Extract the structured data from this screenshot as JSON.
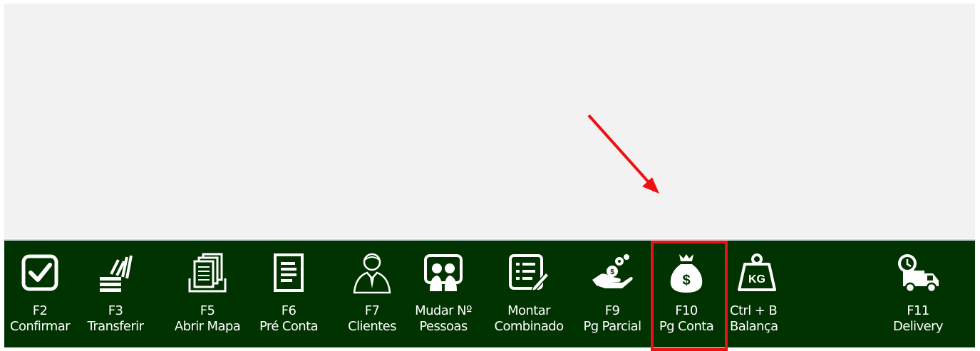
{
  "toolbar": {
    "buttons": [
      {
        "key": "F2",
        "label": "Confirmar",
        "icon": "checkbox-icon"
      },
      {
        "key": "F3",
        "label": "Transferir",
        "icon": "transfer-icon"
      },
      {
        "key": "F5",
        "label": "Abrir Mapa",
        "icon": "documents-stack-icon"
      },
      {
        "key": "F6",
        "label": "Pré Conta",
        "icon": "document-icon"
      },
      {
        "key": "F7",
        "label": "Clientes",
        "icon": "person-icon"
      },
      {
        "key": "Mudar Nº",
        "label": "Pessoas",
        "icon": "people-board-icon"
      },
      {
        "key": "Montar",
        "label": "Combinado",
        "icon": "list-edit-icon"
      },
      {
        "key": "F9",
        "label": "Pg Parcial",
        "icon": "hand-coins-icon"
      },
      {
        "key": "F10",
        "label": "Pg Conta",
        "icon": "money-bag-icon"
      },
      {
        "key": "Ctrl + B",
        "label": "Balança",
        "icon": "weight-kg-icon"
      },
      {
        "key": "F11",
        "label": "Delivery",
        "icon": "delivery-truck-icon"
      }
    ]
  },
  "annotation": {
    "highlighted_button": "F10",
    "highlight_color": "#ee1111",
    "arrow_color": "#ee1111"
  },
  "colors": {
    "toolbar_bg": "#003300",
    "text": "#ffffff"
  }
}
